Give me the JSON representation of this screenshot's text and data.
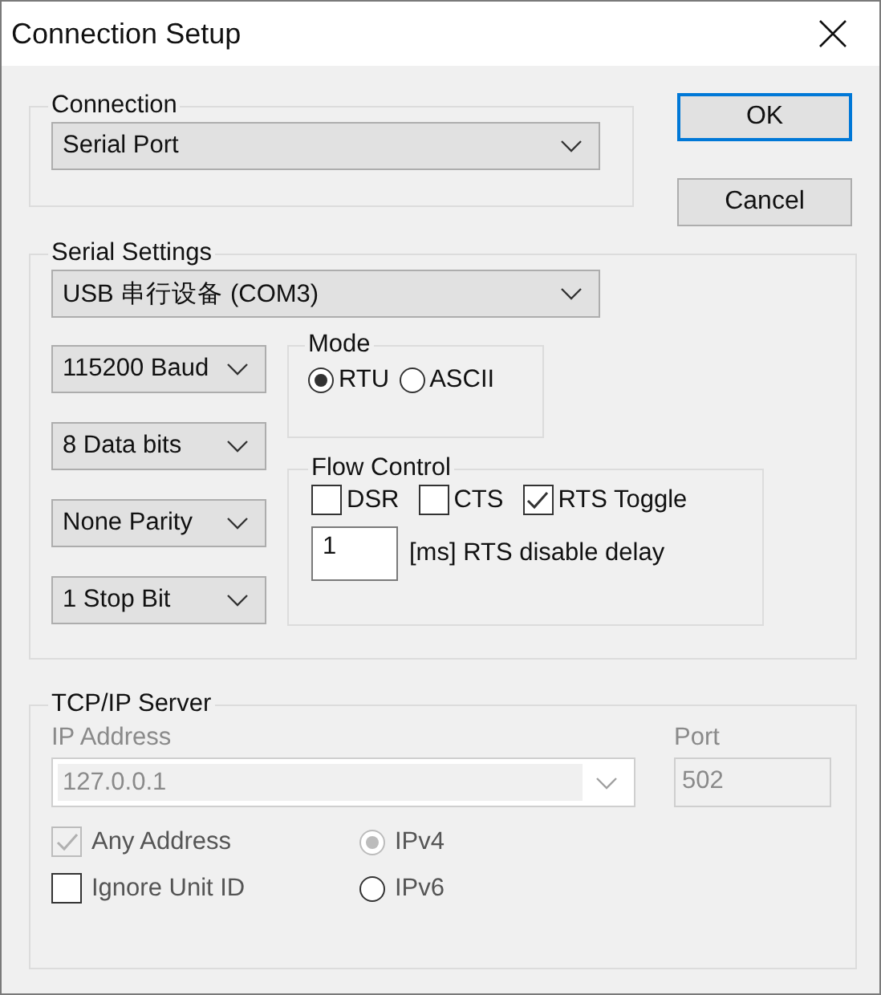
{
  "window": {
    "title": "Connection Setup"
  },
  "buttons": [
    {
      "label": "OK",
      "default": true
    },
    {
      "label": "Cancel",
      "default": false
    }
  ],
  "connection": {
    "legend": "Connection",
    "type": "Serial Port"
  },
  "serial_settings": {
    "legend": "Serial Settings",
    "port": "USB 串行设备 (COM3)",
    "line_settings": [
      "115200 Baud",
      "8 Data bits",
      "None Parity",
      "1 Stop Bit"
    ],
    "mode": {
      "legend": "Mode",
      "options": [
        {
          "label": "RTU",
          "selected": true
        },
        {
          "label": "ASCII",
          "selected": false
        }
      ]
    },
    "flow_control": {
      "legend": "Flow Control",
      "options": [
        {
          "label": "DSR",
          "checked": false
        },
        {
          "label": "CTS",
          "checked": false
        },
        {
          "label": "RTS Toggle",
          "checked": true
        }
      ],
      "rts_delay": {
        "value": "1",
        "label": "[ms] RTS disable delay"
      }
    }
  },
  "tcp_ip_server": {
    "legend": "TCP/IP Server",
    "disabled": true,
    "ip_address_label": "IP Address",
    "ip_address": "127.0.0.1",
    "port_label": "Port",
    "port": "502",
    "checks": [
      {
        "label": "Any Address",
        "checked": true,
        "disabled": true
      },
      {
        "label": "Ignore Unit ID",
        "checked": false,
        "disabled": false
      }
    ],
    "ip_version": [
      {
        "label": "IPv4",
        "selected": true,
        "disabled": true
      },
      {
        "label": "IPv6",
        "selected": false,
        "disabled": false
      }
    ]
  }
}
